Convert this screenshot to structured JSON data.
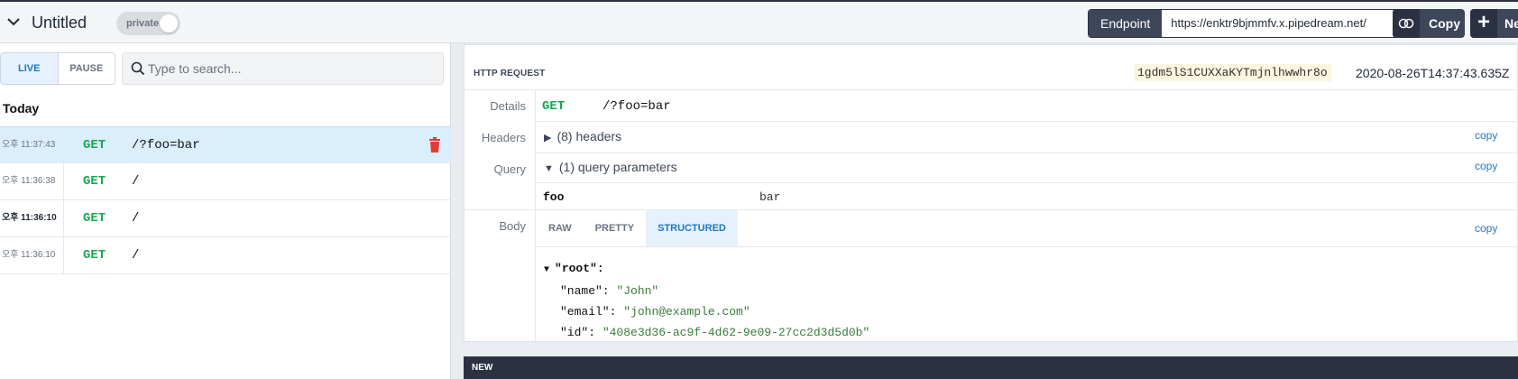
{
  "topbar": {
    "title": "Untitled",
    "private_label": "private",
    "endpoint_label": "Endpoint",
    "endpoint_url": "https://enktr9bjmmfv.x.pipedream.net/",
    "copy_label": "Copy",
    "new_label": "New"
  },
  "sidebar": {
    "live_label": "LIVE",
    "pause_label": "PAUSE",
    "search_placeholder": "Type to search...",
    "group_label": "Today",
    "requests": [
      {
        "time": "오후 11:37:43",
        "method": "GET",
        "path": "/?foo=bar"
      },
      {
        "time": "오후 11:36:38",
        "method": "GET",
        "path": "/"
      },
      {
        "time": "오후 11:36:10",
        "method": "GET",
        "path": "/"
      },
      {
        "time": "오후 11:36:10",
        "method": "GET",
        "path": "/"
      }
    ]
  },
  "request": {
    "header_label": "HTTP REQUEST",
    "request_id": "1gdm5lS1CUXXaKYTmjnlhwwhr8o",
    "timestamp": "2020-08-26T14:37:43.635Z",
    "labels": {
      "details": "Details",
      "headers": "Headers",
      "query": "Query",
      "body": "Body"
    },
    "method": "GET",
    "path": "/?foo=bar",
    "headers_summary": "(8) headers",
    "query_summary": "(1) query parameters",
    "query_params": [
      {
        "key": "foo",
        "value": "bar"
      }
    ],
    "copy_label": "copy",
    "body_tabs": [
      "RAW",
      "PRETTY",
      "STRUCTURED"
    ],
    "body_tree": {
      "root": "\"root\":",
      "name_key": "\"name\":",
      "name_val": "\"John\"",
      "email_key": "\"email\":",
      "email_val": "\"john@example.com\"",
      "id_key": "\"id\":",
      "id_val": "\"408e3d36-ac9f-4d62-9e09-27cc2d3d5d0b\""
    }
  },
  "new_section": {
    "label": "NEW"
  },
  "colors": {
    "accent": "#1f77c2",
    "get_method": "#1aa650",
    "dark": "#2b3142"
  }
}
